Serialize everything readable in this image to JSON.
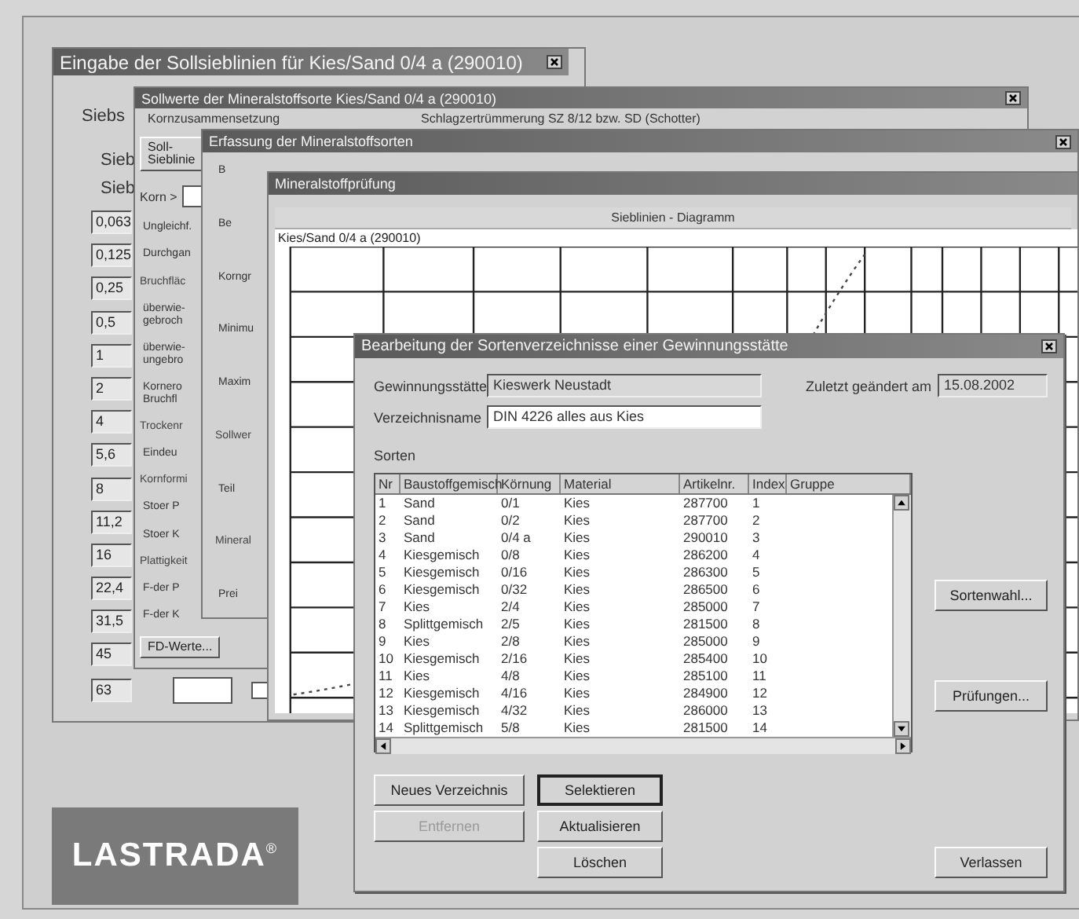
{
  "sieblinien_window": {
    "title": "Eingabe der Sollsieblinien für Kies/Sand 0/4 a (290010)",
    "labels": [
      "Siebs",
      "Sieb",
      "Sieb"
    ],
    "sieves": [
      "0,063",
      "0,125",
      "0,25",
      "0,5",
      "1",
      "2",
      "4",
      "5,6",
      "8",
      "11,2",
      "16",
      "22,4",
      "31,5",
      "45",
      "63"
    ],
    "checkbox": {
      "checked": false
    }
  },
  "sollwerte_window": {
    "title": "Sollwerte der Mineralstoffsorte Kies/Sand 0/4 a (290010)",
    "headings": [
      "Kornzusammensetzung",
      "Schlagzertrümmerung SZ 8/12 bzw. SD (Schotter)"
    ],
    "items": [
      {
        "kind": "button",
        "label": "Soll-\nSieblinie"
      },
      {
        "kind": "field",
        "label": "Korn >"
      },
      {
        "kind": "label",
        "label": "Ungleichf."
      },
      {
        "kind": "label",
        "label": "Durchgan"
      },
      {
        "kind": "group",
        "label": "Bruchfläc"
      },
      {
        "kind": "label",
        "label": "überwie-\ngebroch"
      },
      {
        "kind": "label",
        "label": "überwie-\nungebro"
      },
      {
        "kind": "label",
        "label": "Kornero\nBruchfl"
      },
      {
        "kind": "group",
        "label": "Trockenr"
      },
      {
        "kind": "label",
        "label": "Eindeu"
      },
      {
        "kind": "group",
        "label": "Kornformi"
      },
      {
        "kind": "label",
        "label": "Stoer P"
      },
      {
        "kind": "label",
        "label": "Stoer K"
      },
      {
        "kind": "group",
        "label": "Plattigkeit"
      },
      {
        "kind": "label",
        "label": "F-der P"
      },
      {
        "kind": "label",
        "label": "F-der K"
      },
      {
        "kind": "button",
        "label": "FD-Werte..."
      }
    ]
  },
  "erfassung_window": {
    "title": "Erfassung der Mineralstoffsorten",
    "items": [
      {
        "kind": "label",
        "label": "B"
      },
      {
        "kind": "label",
        "label": "Be"
      },
      {
        "kind": "label",
        "label": "Korngr"
      },
      {
        "kind": "label",
        "label": "Minimu"
      },
      {
        "kind": "label",
        "label": "Maxim"
      },
      {
        "kind": "group",
        "label": "Sollwer"
      },
      {
        "kind": "label",
        "label": "Teil"
      },
      {
        "kind": "group",
        "label": "Mineral"
      },
      {
        "kind": "label",
        "label": "Prei"
      }
    ]
  },
  "pruefung_window": {
    "title": "Mineralstoffprüfung",
    "chart_title": "Sieblinien - Diagramm",
    "chart_subtitle": "Kies/Sand 0/4 a (290010)"
  },
  "dialog": {
    "title": "Bearbeitung der Sortenverzeichnisse einer Gewinnungsstätte",
    "source_label": "Gewinnungsstätte",
    "source_value": "Kieswerk Neustadt",
    "changed_label": "Zuletzt geändert am",
    "changed_value": "15.08.2002",
    "name_label": "Verzeichnisname",
    "name_value": "DIN 4226 alles aus Kies",
    "list_label": "Sorten",
    "columns": [
      "Nr",
      "Baustoffgemisch",
      "Körnung",
      "Material",
      "Artikelnr.",
      "Index",
      "Gruppe"
    ],
    "rows": [
      [
        "1",
        "Sand",
        "0/1",
        "Kies",
        "287700",
        "1"
      ],
      [
        "2",
        "Sand",
        "0/2",
        "Kies",
        "287700",
        "2"
      ],
      [
        "3",
        "Sand",
        "0/4 a",
        "Kies",
        "290010",
        "3"
      ],
      [
        "4",
        "Kiesgemisch",
        "0/8",
        "Kies",
        "286200",
        "4"
      ],
      [
        "5",
        "Kiesgemisch",
        "0/16",
        "Kies",
        "286300",
        "5"
      ],
      [
        "6",
        "Kiesgemisch",
        "0/32",
        "Kies",
        "286500",
        "6"
      ],
      [
        "7",
        "Kies",
        "2/4",
        "Kies",
        "285000",
        "7"
      ],
      [
        "8",
        "Splittgemisch",
        "2/5",
        "Kies",
        "281500",
        "8"
      ],
      [
        "9",
        "Kies",
        "2/8",
        "Kies",
        "285000",
        "9"
      ],
      [
        "10",
        "Kiesgemisch",
        "2/16",
        "Kies",
        "285400",
        "10"
      ],
      [
        "11",
        "Kies",
        "4/8",
        "Kies",
        "285100",
        "11"
      ],
      [
        "12",
        "Kiesgemisch",
        "4/16",
        "Kies",
        "284900",
        "12"
      ],
      [
        "13",
        "Kiesgemisch",
        "4/32",
        "Kies",
        "286000",
        "13"
      ],
      [
        "14",
        "Splittgemisch",
        "5/8",
        "Kies",
        "281500",
        "14"
      ]
    ],
    "side_buttons": [
      {
        "label": "Sortenwahl..."
      },
      {
        "label": "Prüfungen..."
      }
    ],
    "buttons": [
      {
        "label": "Neues Verzeichnis",
        "disabled": false,
        "default": false
      },
      {
        "label": "Selektieren",
        "disabled": false,
        "default": true
      },
      {
        "label": "Entfernen",
        "disabled": true,
        "default": false
      },
      {
        "label": "Aktualisieren",
        "disabled": false,
        "default": false
      },
      {
        "label": "Löschen",
        "disabled": false,
        "default": false
      }
    ],
    "exit_button": "Verlassen"
  },
  "logo": {
    "text": "LASTRADA$^{®}$"
  }
}
